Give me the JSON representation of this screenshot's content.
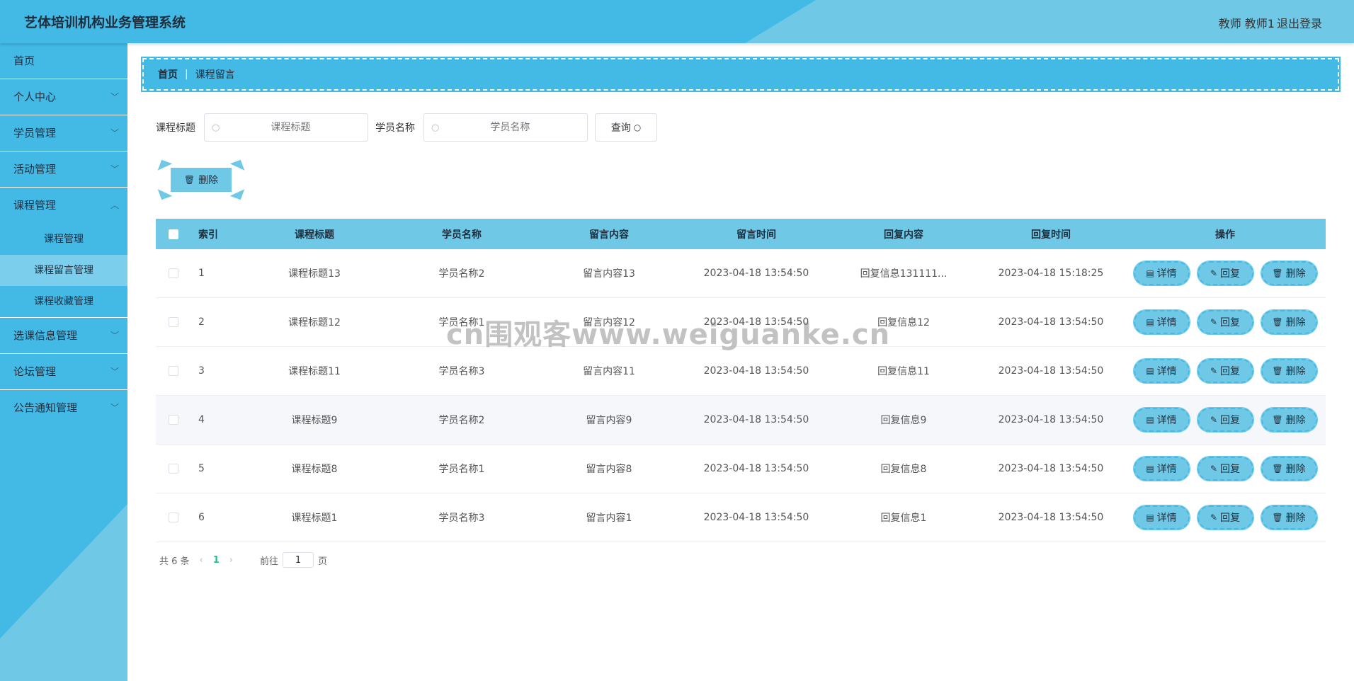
{
  "header": {
    "title": "艺体培训机构业务管理系统",
    "user": "教师 教师1",
    "logout": "退出登录"
  },
  "sidebar": {
    "items": [
      {
        "label": "首页",
        "expandable": false
      },
      {
        "label": "个人中心",
        "expandable": true
      },
      {
        "label": "学员管理",
        "expandable": true
      },
      {
        "label": "活动管理",
        "expandable": true
      },
      {
        "label": "课程管理",
        "expandable": true,
        "expanded": true
      },
      {
        "label": "选课信息管理",
        "expandable": true
      },
      {
        "label": "论坛管理",
        "expandable": true
      },
      {
        "label": "公告通知管理",
        "expandable": true
      }
    ],
    "sub_items": [
      "课程管理",
      "课程留言管理",
      "课程收藏管理"
    ],
    "active_sub": "课程留言管理"
  },
  "breadcrumb": {
    "home": "首页",
    "sep": "|",
    "current": "课程留言"
  },
  "search": {
    "title_label": "课程标题",
    "title_placeholder": "课程标题",
    "student_label": "学员名称",
    "student_placeholder": "学员名称",
    "query_label": "查询"
  },
  "toolbar": {
    "delete_label": "删除"
  },
  "table": {
    "headers": [
      "索引",
      "课程标题",
      "学员名称",
      "留言内容",
      "留言时间",
      "回复内容",
      "回复时间",
      "操作"
    ],
    "rows": [
      [
        "1",
        "课程标题13",
        "学员名称2",
        "留言内容13",
        "2023-04-18 13:54:50",
        "回复信息131111...",
        "2023-04-18 15:18:25"
      ],
      [
        "2",
        "课程标题12",
        "学员名称1",
        "留言内容12",
        "2023-04-18 13:54:50",
        "回复信息12",
        "2023-04-18 13:54:50"
      ],
      [
        "3",
        "课程标题11",
        "学员名称3",
        "留言内容11",
        "2023-04-18 13:54:50",
        "回复信息11",
        "2023-04-18 13:54:50"
      ],
      [
        "4",
        "课程标题9",
        "学员名称2",
        "留言内容9",
        "2023-04-18 13:54:50",
        "回复信息9",
        "2023-04-18 13:54:50"
      ],
      [
        "5",
        "课程标题8",
        "学员名称1",
        "留言内容8",
        "2023-04-18 13:54:50",
        "回复信息8",
        "2023-04-18 13:54:50"
      ],
      [
        "6",
        "课程标题1",
        "学员名称3",
        "留言内容1",
        "2023-04-18 13:54:50",
        "回复信息1",
        "2023-04-18 13:54:50"
      ]
    ],
    "ops": {
      "detail": "详情",
      "reply": "回复",
      "delete": "删除"
    }
  },
  "pager": {
    "total": "共 6 条",
    "page": "1",
    "goto_prefix": "前往",
    "goto_value": "1",
    "goto_suffix": "页"
  },
  "watermark": "cn围观客www.weiguanke.cn",
  "colors": {
    "primary": "#43b9e6",
    "light": "#6fc9e6",
    "active_sub": "#7ccfec",
    "page_accent": "#27c08b"
  }
}
